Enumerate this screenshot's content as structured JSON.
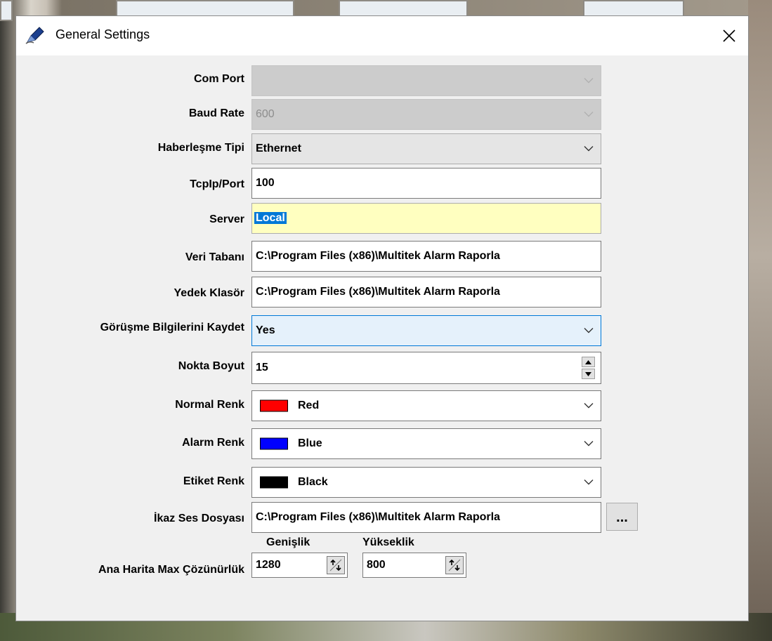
{
  "window": {
    "title": "General Settings",
    "icon": "pen-icon",
    "close_glyph": "✕"
  },
  "form": {
    "com_port": {
      "label": "Com Port",
      "value": ""
    },
    "baud_rate": {
      "label": "Baud Rate",
      "value": "600"
    },
    "comm_type": {
      "label": "Haberleşme Tipi",
      "value": "Ethernet"
    },
    "tcpip_port": {
      "label": "TcpIp/Port",
      "value": "100"
    },
    "server": {
      "label": "Server",
      "value": "Local"
    },
    "database": {
      "label": "Veri Tabanı",
      "value": "C:\\Program Files (x86)\\Multitek Alarm Raporla"
    },
    "backup_folder": {
      "label": "Yedek Klasör",
      "value": "C:\\Program Files (x86)\\Multitek Alarm Raporla"
    },
    "save_calls": {
      "label": "Görüşme Bilgilerini Kaydet",
      "value": "Yes"
    },
    "point_size": {
      "label": "Nokta Boyut",
      "value": "15"
    },
    "normal_color": {
      "label": "Normal Renk",
      "value": "Red",
      "swatch": "#ff0000"
    },
    "alarm_color": {
      "label": "Alarm Renk",
      "value": "Blue",
      "swatch": "#0000ff"
    },
    "label_color": {
      "label": "Etiket Renk",
      "value": "Black",
      "swatch": "#000000"
    },
    "warning_sound": {
      "label": "İkaz Ses Dosyası",
      "value": "C:\\Program Files (x86)\\Multitek Alarm Raporla",
      "browse_label": "..."
    },
    "map_resolution": {
      "label": "Ana Harita Max Çözünürlük",
      "width_label": "Genişlik",
      "width_value": "1280",
      "height_label": "Yükseklik",
      "height_value": "800"
    }
  },
  "colors": {
    "accent": "#0078d7",
    "highlight": "#ffffc0",
    "dialog_bg": "#f0f0f0"
  }
}
